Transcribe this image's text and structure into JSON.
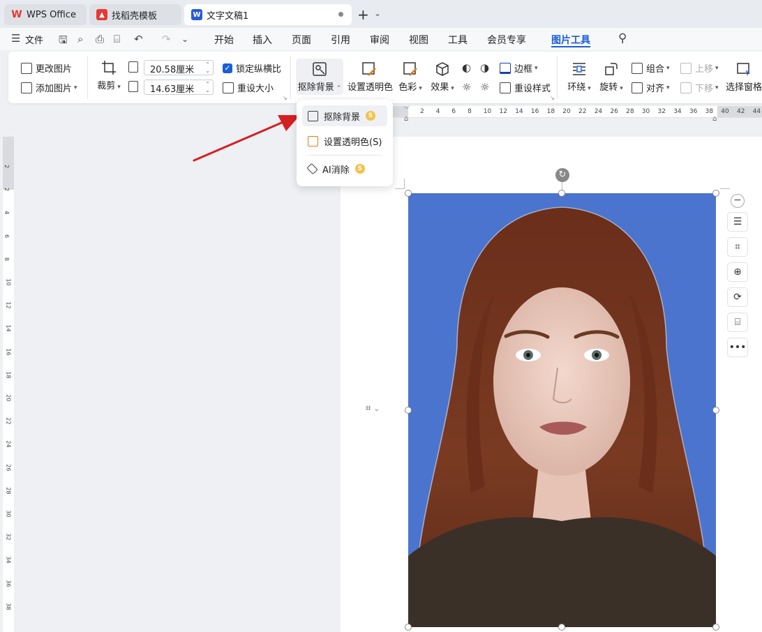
{
  "tabs": [
    {
      "label": "WPS Office",
      "icon": "wps-logo-icon"
    },
    {
      "label": "找稻壳模板",
      "icon": "docer-icon"
    },
    {
      "label": "文字文稿1",
      "icon": "writer-doc-icon"
    }
  ],
  "new_tab": "+",
  "menu": {
    "file": "文件",
    "items": [
      "开始",
      "插入",
      "页面",
      "引用",
      "审阅",
      "视图",
      "工具",
      "会员专享",
      "图片工具"
    ],
    "active": "图片工具"
  },
  "ribbon": {
    "change_picture": "更改图片",
    "add_picture": "添加图片",
    "crop": "裁剪",
    "width_value": "20.58厘米",
    "height_value": "14.63厘米",
    "lock_ratio": "锁定纵横比",
    "reset_size": "重设大小",
    "remove_bg": "抠除背景",
    "set_transparent": "设置透明色",
    "color": "色彩",
    "effects": "效果",
    "border": "边框",
    "reset_style": "重设样式",
    "wrap": "环绕",
    "rotate": "旋转",
    "group": "组合",
    "align": "对齐",
    "bring_forward": "上移",
    "send_backward": "下移",
    "selection_pane": "选择窗格"
  },
  "dropdown": {
    "items": [
      {
        "label": "抠除背景",
        "coin": "S",
        "icon": "remove-bg-icon"
      },
      {
        "label": "设置透明色(S)",
        "icon": "transparent-color-icon"
      },
      {
        "label": "AI消除",
        "coin": "S",
        "icon": "eraser-icon"
      }
    ]
  },
  "hruler_ticks": [
    "2",
    "4",
    "6",
    "8",
    "10",
    "12",
    "14",
    "16",
    "18",
    "20",
    "22",
    "24",
    "26",
    "28",
    "30",
    "32",
    "34",
    "36",
    "38",
    "40",
    "42",
    "44"
  ],
  "vruler_ticks": [
    "2",
    "2",
    "4",
    "6",
    "8",
    "10",
    "12",
    "14",
    "16",
    "18",
    "20",
    "22",
    "24",
    "26",
    "28",
    "30",
    "32",
    "34",
    "36",
    "38"
  ],
  "colors": {
    "accent": "#1b5fd6",
    "photo_bg": "#4a74cd",
    "arrow": "#d42020",
    "coin": "#f4c24a"
  }
}
